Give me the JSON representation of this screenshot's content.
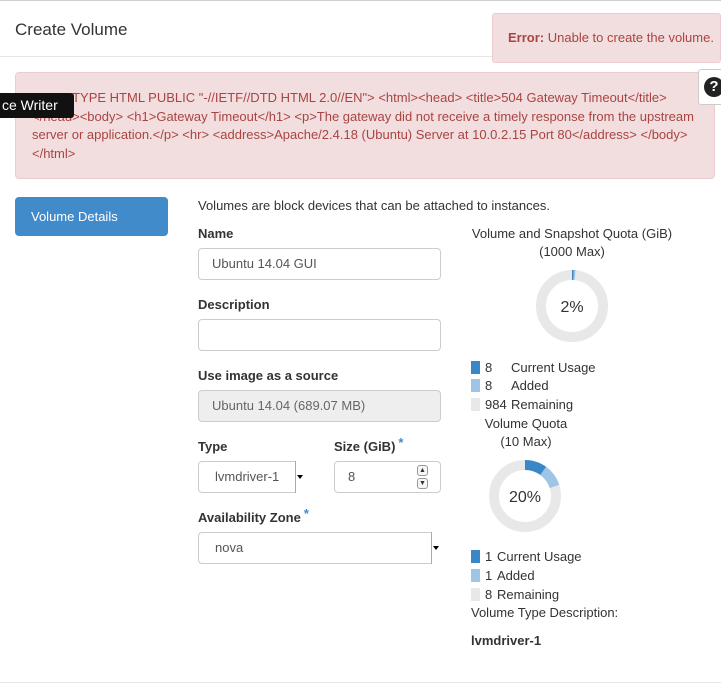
{
  "modal": {
    "title": "Create Volume"
  },
  "error_toast": {
    "prefix": "Error:",
    "message": "Unable to create the volume."
  },
  "help_button": {
    "icon": "question-circle-icon",
    "glyph": "?"
  },
  "tooltip": {
    "text": "ce Writer"
  },
  "error_html": {
    "text": "<!DOCTYPE HTML PUBLIC \"-//IETF//DTD HTML 2.0//EN\"> <html><head> <title>504 Gateway Timeout</title> </head><body> <h1>Gateway Timeout</h1> <p>The gateway did not receive a timely response from the upstream server or application.</p> <hr> <address>Apache/2.4.18 (Ubuntu) Server at 10.0.2.15 Port 80</address> </body></html>"
  },
  "tabs": [
    {
      "label": "Volume Details",
      "active": true
    }
  ],
  "form": {
    "intro": "Volumes are block devices that can be attached to instances.",
    "name": {
      "label": "Name",
      "value": "Ubuntu 14.04 GUI"
    },
    "description": {
      "label": "Description",
      "value": ""
    },
    "source": {
      "label": "Use image as a source",
      "value": "Ubuntu 14.04 (689.07 MB)"
    },
    "type": {
      "label": "Type",
      "value": "lvmdriver-1"
    },
    "size": {
      "label": "Size (GiB)",
      "required_mark": "*",
      "value": "8"
    },
    "availability_zone": {
      "label": "Availability Zone",
      "required_mark": "*",
      "value": "nova"
    }
  },
  "quotas": {
    "snapshot": {
      "title_line1": "Volume and Snapshot Quota (GiB)",
      "title_line2": "(1000 Max)",
      "percent_label": "2%",
      "max": 1000,
      "current": 8,
      "added": 8,
      "remaining": 984,
      "legend": [
        {
          "value": "8",
          "label": "Current Usage"
        },
        {
          "value": "8",
          "label": "Added"
        },
        {
          "value": "984",
          "label": "Remaining"
        }
      ]
    },
    "volume": {
      "title_line1": "Volume Quota",
      "title_line2": "(10 Max)",
      "percent_label": "20%",
      "max": 10,
      "current": 1,
      "added": 1,
      "remaining": 8,
      "legend": [
        {
          "value": "1",
          "label": "Current Usage"
        },
        {
          "value": "1",
          "label": "Added"
        },
        {
          "value": "8",
          "label": "Remaining"
        }
      ]
    }
  },
  "volume_type": {
    "label": "Volume Type Description:",
    "value": "lvmdriver-1"
  },
  "colors": {
    "current": "#3a87c8",
    "added": "#9fc5e6",
    "remaining": "#e8e8e8",
    "primary": "#428bca",
    "error_text": "#a94442",
    "error_bg": "#f2dede"
  }
}
